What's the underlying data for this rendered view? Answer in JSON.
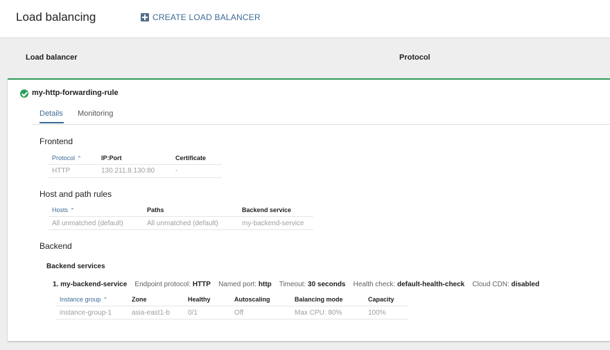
{
  "header": {
    "title": "Load balancing",
    "create_label": "CREATE LOAD BALANCER"
  },
  "list": {
    "col_load_balancer": "Load balancer",
    "col_protocol": "Protocol"
  },
  "rule": {
    "name": "my-http-forwarding-rule",
    "tabs": [
      "Details",
      "Monitoring"
    ]
  },
  "frontend": {
    "title": "Frontend",
    "headers": [
      "Protocol",
      "IP:Port",
      "Certificate"
    ],
    "row": [
      "HTTP",
      "130.211.8.130:80",
      "-"
    ]
  },
  "host_path": {
    "title": "Host and path rules",
    "headers": [
      "Hosts",
      "Paths",
      "Backend service"
    ],
    "row": [
      "All unmatched (default)",
      "All unmatched (default)",
      "my-backend-service"
    ]
  },
  "backend": {
    "title": "Backend",
    "services_title": "Backend services",
    "service": {
      "index": "1.",
      "name": "my-backend-service",
      "endpoint_label": "Endpoint protocol:",
      "endpoint_value": "HTTP",
      "port_label": "Named port:",
      "port_value": "http",
      "timeout_label": "Timeout:",
      "timeout_value": "30 seconds",
      "health_label": "Health check:",
      "health_value": "default-health-check",
      "cdn_label": "Cloud CDN:",
      "cdn_value": "disabled"
    },
    "headers": [
      "Instance group",
      "Zone",
      "Healthy",
      "Autoscaling",
      "Balancing mode",
      "Capacity"
    ],
    "row": [
      "instance-group-1",
      "asia-east1-b",
      "0/1",
      "Off",
      "Max CPU: 80%",
      "100%"
    ]
  },
  "colors": {
    "accent": "#3c6a96",
    "success": "#2e9e5b"
  }
}
